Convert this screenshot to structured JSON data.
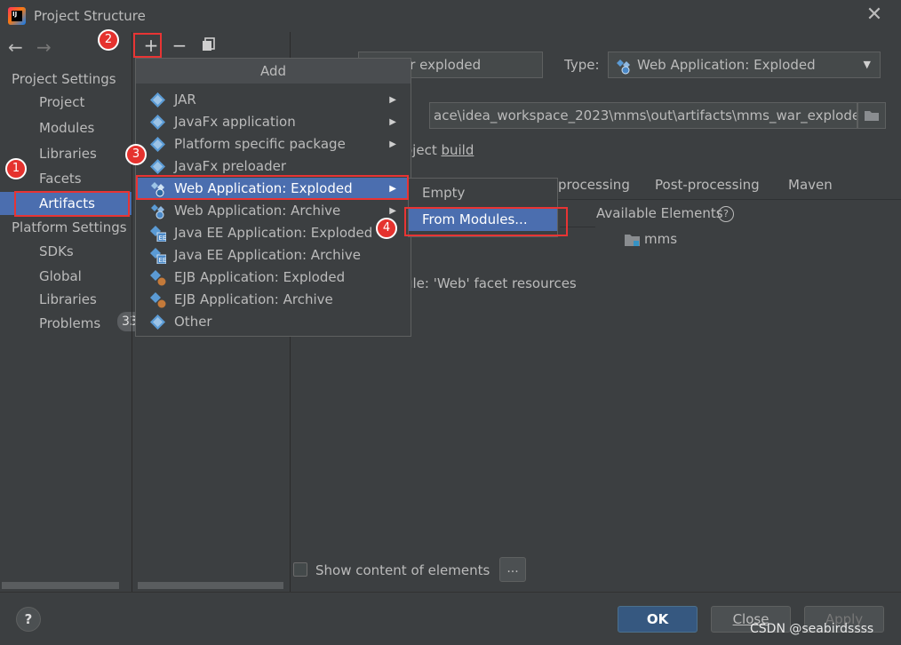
{
  "window": {
    "title": "Project Structure",
    "close_glyph": "✕"
  },
  "nav": {
    "back_glyph": "←",
    "forward_glyph": "→",
    "project_settings_label": "Project Settings",
    "platform_settings_label": "Platform Settings",
    "items": {
      "project": "Project",
      "modules": "Modules",
      "libraries": "Libraries",
      "facets": "Facets",
      "artifacts": "Artifacts",
      "sdks": "SDKs",
      "global_libraries": "Global Libraries",
      "problems": "Problems"
    },
    "problems_count": "33",
    "selected": "Artifacts"
  },
  "toolbar": {
    "add_glyph": "+",
    "remove_glyph": "−"
  },
  "popup": {
    "header": "Add",
    "items": [
      {
        "label": "JAR",
        "has_submenu": true
      },
      {
        "label": "JavaFx application",
        "has_submenu": true
      },
      {
        "label": "Platform specific package",
        "has_submenu": true
      },
      {
        "label": "JavaFx preloader",
        "has_submenu": false
      },
      {
        "label": "Web Application: Exploded",
        "has_submenu": true,
        "active": true
      },
      {
        "label": "Web Application: Archive",
        "has_submenu": true
      },
      {
        "label": "Java EE Application: Exploded",
        "has_submenu": false
      },
      {
        "label": "Java EE Application: Archive",
        "has_submenu": false
      },
      {
        "label": "EJB Application: Exploded",
        "has_submenu": false
      },
      {
        "label": "EJB Application: Archive",
        "has_submenu": false
      },
      {
        "label": "Other",
        "has_submenu": false
      }
    ],
    "submenu_arrow": "▶",
    "submenu": [
      {
        "label": "Empty"
      },
      {
        "label": "From Modules...",
        "active": true
      }
    ]
  },
  "details": {
    "name_value": "ar exploded",
    "type_label": "Type:",
    "type_value": "Web Application: Exploded",
    "output_label": ":",
    "output_path": "ace\\idea_workspace_2023\\mms\\out\\artifacts\\mms_war_exploded",
    "include_build_prefix": "oject ",
    "include_build_underlined": "build",
    "tabs": {
      "pre": "processing",
      "post": "Post-processing",
      "maven": "Maven"
    },
    "available_elements_label": "Available Elements",
    "help_glyph": "?",
    "tree_item": "mms",
    "module_resource": "ule: 'Web' facet resources",
    "show_content_label": "Show content of elements",
    "ellipsis": "..."
  },
  "footer": {
    "help": "?",
    "ok": "OK",
    "close": "Close",
    "apply": "Apply"
  },
  "annotations": {
    "step1": "1",
    "step2": "2",
    "step3": "3",
    "step4": "4"
  },
  "watermark": "CSDN @seabirdssss",
  "colors": {
    "selection": "#4b6eaf",
    "annotation_red": "#e83434",
    "background": "#3c3f41"
  }
}
